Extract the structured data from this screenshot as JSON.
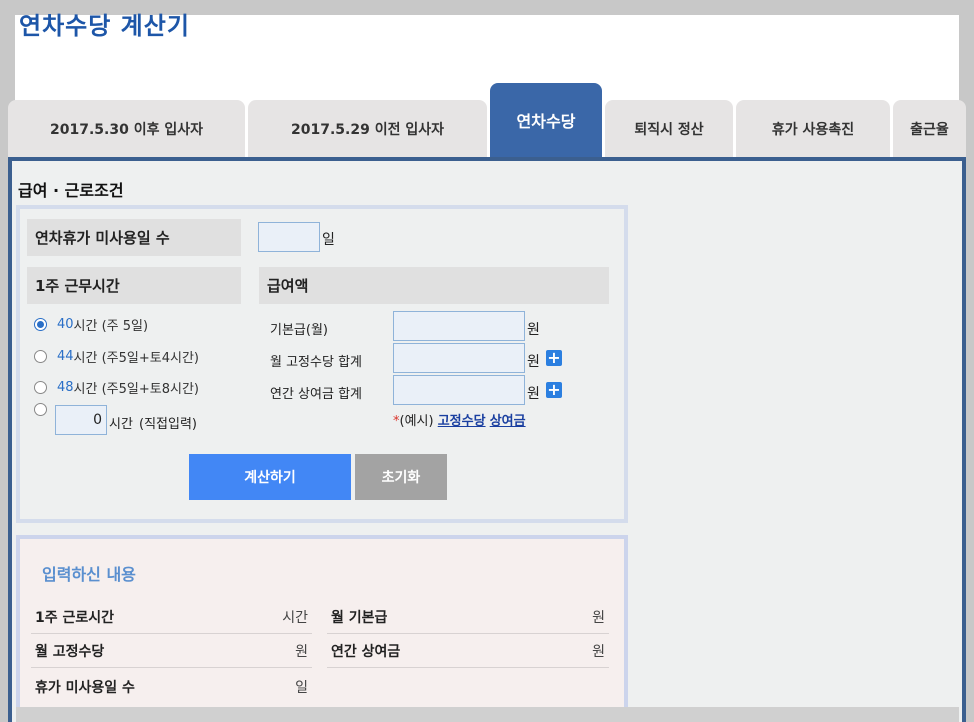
{
  "app": {
    "title": "연차수당 계산기"
  },
  "tabs": [
    {
      "label": "2017.5.30 이후 입사자"
    },
    {
      "label": "2017.5.29 이전 입사자"
    },
    {
      "label": "연차수당"
    },
    {
      "label": "퇴직시 정산"
    },
    {
      "label": "휴가 사용촉진"
    },
    {
      "label": "출근율"
    }
  ],
  "section": {
    "title": "급여 · 근로조건"
  },
  "unused_days": {
    "label": "연차휴가 미사용일 수",
    "value": "",
    "unit": "일"
  },
  "work_hours": {
    "header": "1주 근무시간",
    "options": [
      {
        "hours": "40",
        "rest": "시간 (주 5일)",
        "checked": true
      },
      {
        "hours": "44",
        "rest": "시간 (주5일+토4시간)",
        "checked": false
      },
      {
        "hours": "48",
        "rest": "시간 (주5일+토8시간)",
        "checked": false
      }
    ],
    "custom": {
      "value": "0",
      "unit": "시간",
      "note": "(직접입력)"
    }
  },
  "salary": {
    "header": "급여액",
    "rows": [
      {
        "label": "기본급(월)",
        "value": "",
        "unit": "원"
      },
      {
        "label": "월 고정수당 합계",
        "value": "",
        "unit": "원"
      },
      {
        "label": "연간 상여금 합계",
        "value": "",
        "unit": "원"
      }
    ],
    "example": {
      "star": "*",
      "prefix": "(예시)",
      "link1": "고정수당",
      "link2": "상여금"
    }
  },
  "buttons": {
    "calculate": "계산하기",
    "reset": "초기화"
  },
  "result": {
    "title": "입력하신 내용",
    "rows": [
      {
        "label": "1주 근로시간",
        "unit": "시간"
      },
      {
        "label": "월 기본급",
        "unit": "원"
      },
      {
        "label": "월 고정수당",
        "unit": "원"
      },
      {
        "label": "연간 상여금",
        "unit": "원"
      },
      {
        "label": "휴가 미사용일 수",
        "unit": "일"
      }
    ]
  },
  "colors": {
    "brand": "#3a67a8",
    "accent": "#4287f5",
    "title": "#1d56a8"
  }
}
